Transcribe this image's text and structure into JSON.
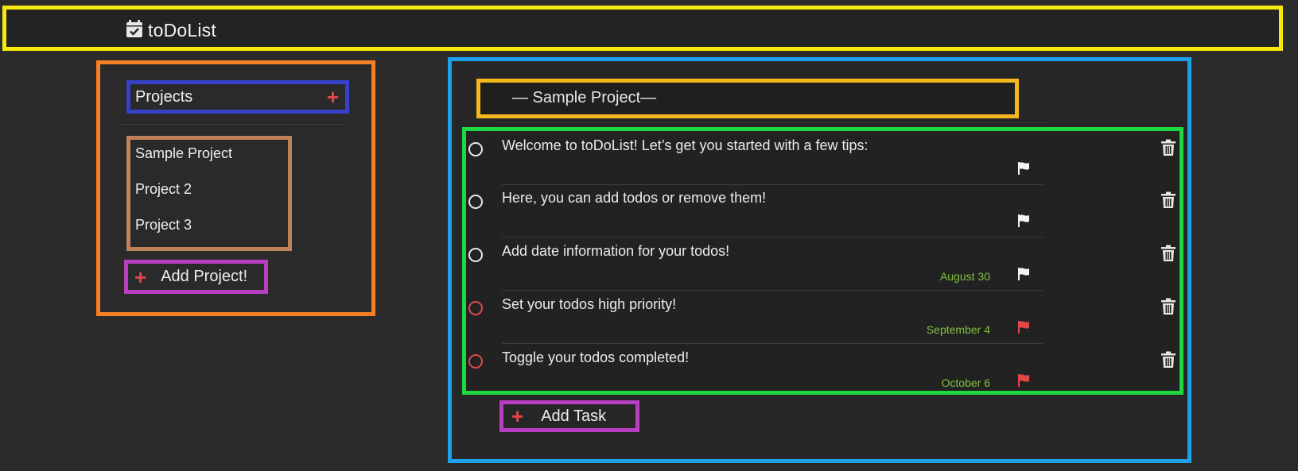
{
  "header": {
    "app_title": "toDoList",
    "icon": "calendar-check-icon"
  },
  "sidebar": {
    "title": "Projects",
    "add_icon": "plus-icon",
    "projects": [
      {
        "label": "Sample Project"
      },
      {
        "label": "Project 2"
      },
      {
        "label": "Project 3"
      }
    ],
    "add_project_label": "Add Project!"
  },
  "main": {
    "project_heading": "— Sample Project—",
    "tasks": [
      {
        "title": "Welcome to toDoList! Let’s get you started with a few tips:",
        "date": "",
        "priority": "normal"
      },
      {
        "title": "Here, you can add todos or remove them!",
        "date": "",
        "priority": "normal"
      },
      {
        "title": "Add date information for your todos!",
        "date": "August 30",
        "priority": "normal"
      },
      {
        "title": "Set your todos high priority!",
        "date": "September 4",
        "priority": "high"
      },
      {
        "title": "Toggle your todos completed!",
        "date": "October 6",
        "priority": "high"
      }
    ],
    "add_task_label": "Add Task"
  },
  "colors": {
    "background": "#2b2b2b",
    "header_bg": "#232323",
    "accent_red": "#e14747",
    "date_green": "#7fc241",
    "flag_white": "#f2f2f2",
    "outline_yellow": "#f7ea0b",
    "outline_orange": "#f57f25",
    "outline_blue": "#1ea1e8",
    "outline_green": "#1ed840",
    "outline_purple": "#b83ec0",
    "outline_indigo": "#3640c8",
    "outline_tan": "#c08258",
    "outline_gold": "#f5b81c"
  }
}
